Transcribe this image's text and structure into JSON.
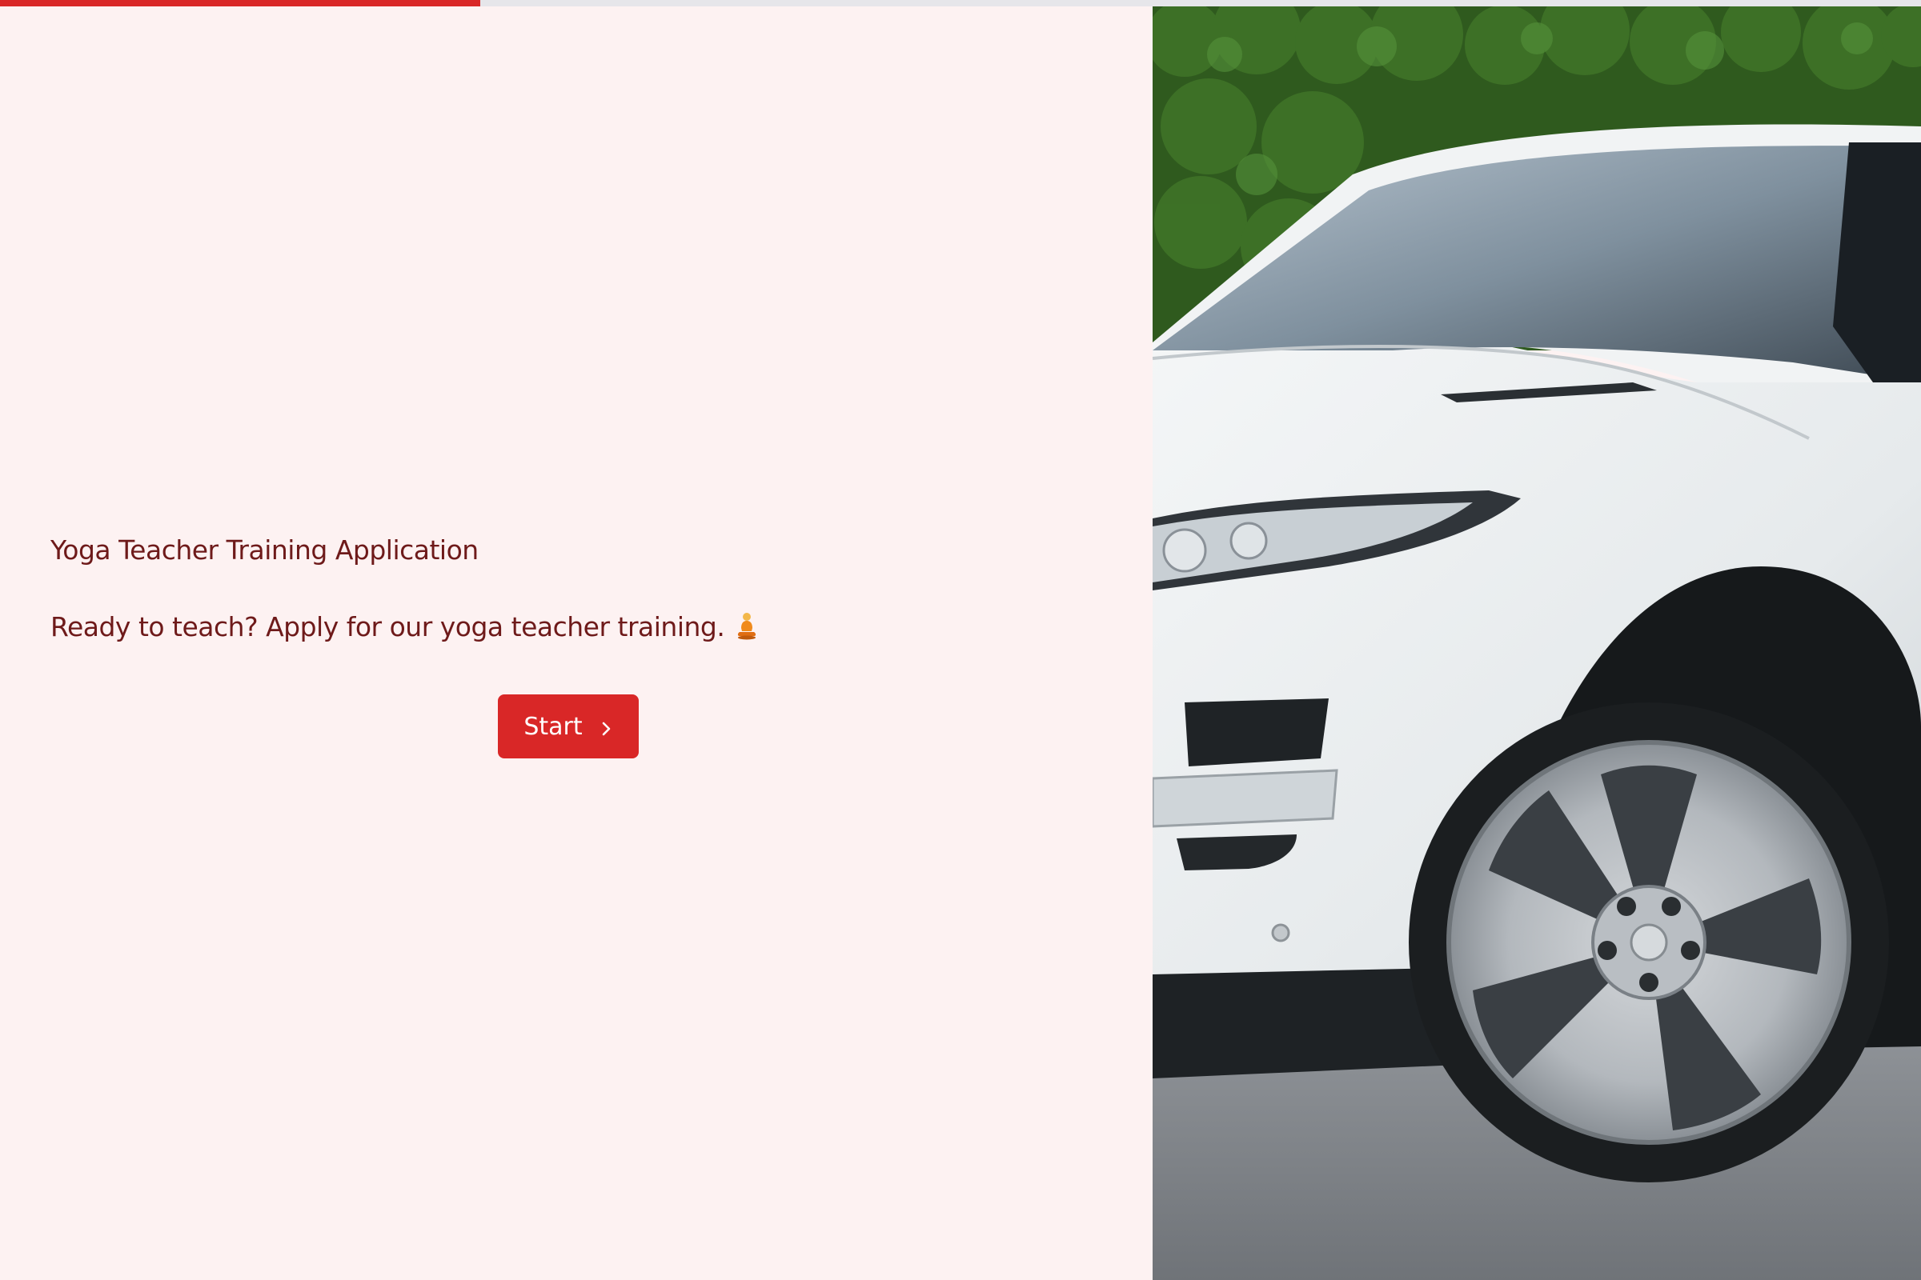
{
  "progress": {
    "fraction": 0.25,
    "color": "#d92727"
  },
  "form": {
    "title": "Yoga Teacher Training Application",
    "subtitle": "Ready to teach? Apply for our yoga teacher training.",
    "subtitle_icon": "person-in-lotus-position-icon",
    "start_label": "Start",
    "start_icon": "chevron-right-icon"
  },
  "colors": {
    "background": "#fdf2f2",
    "text": "#6e1a1a",
    "accent": "#d92727"
  },
  "hero_image": {
    "subject": "white SUV parked in front of green hedge"
  }
}
